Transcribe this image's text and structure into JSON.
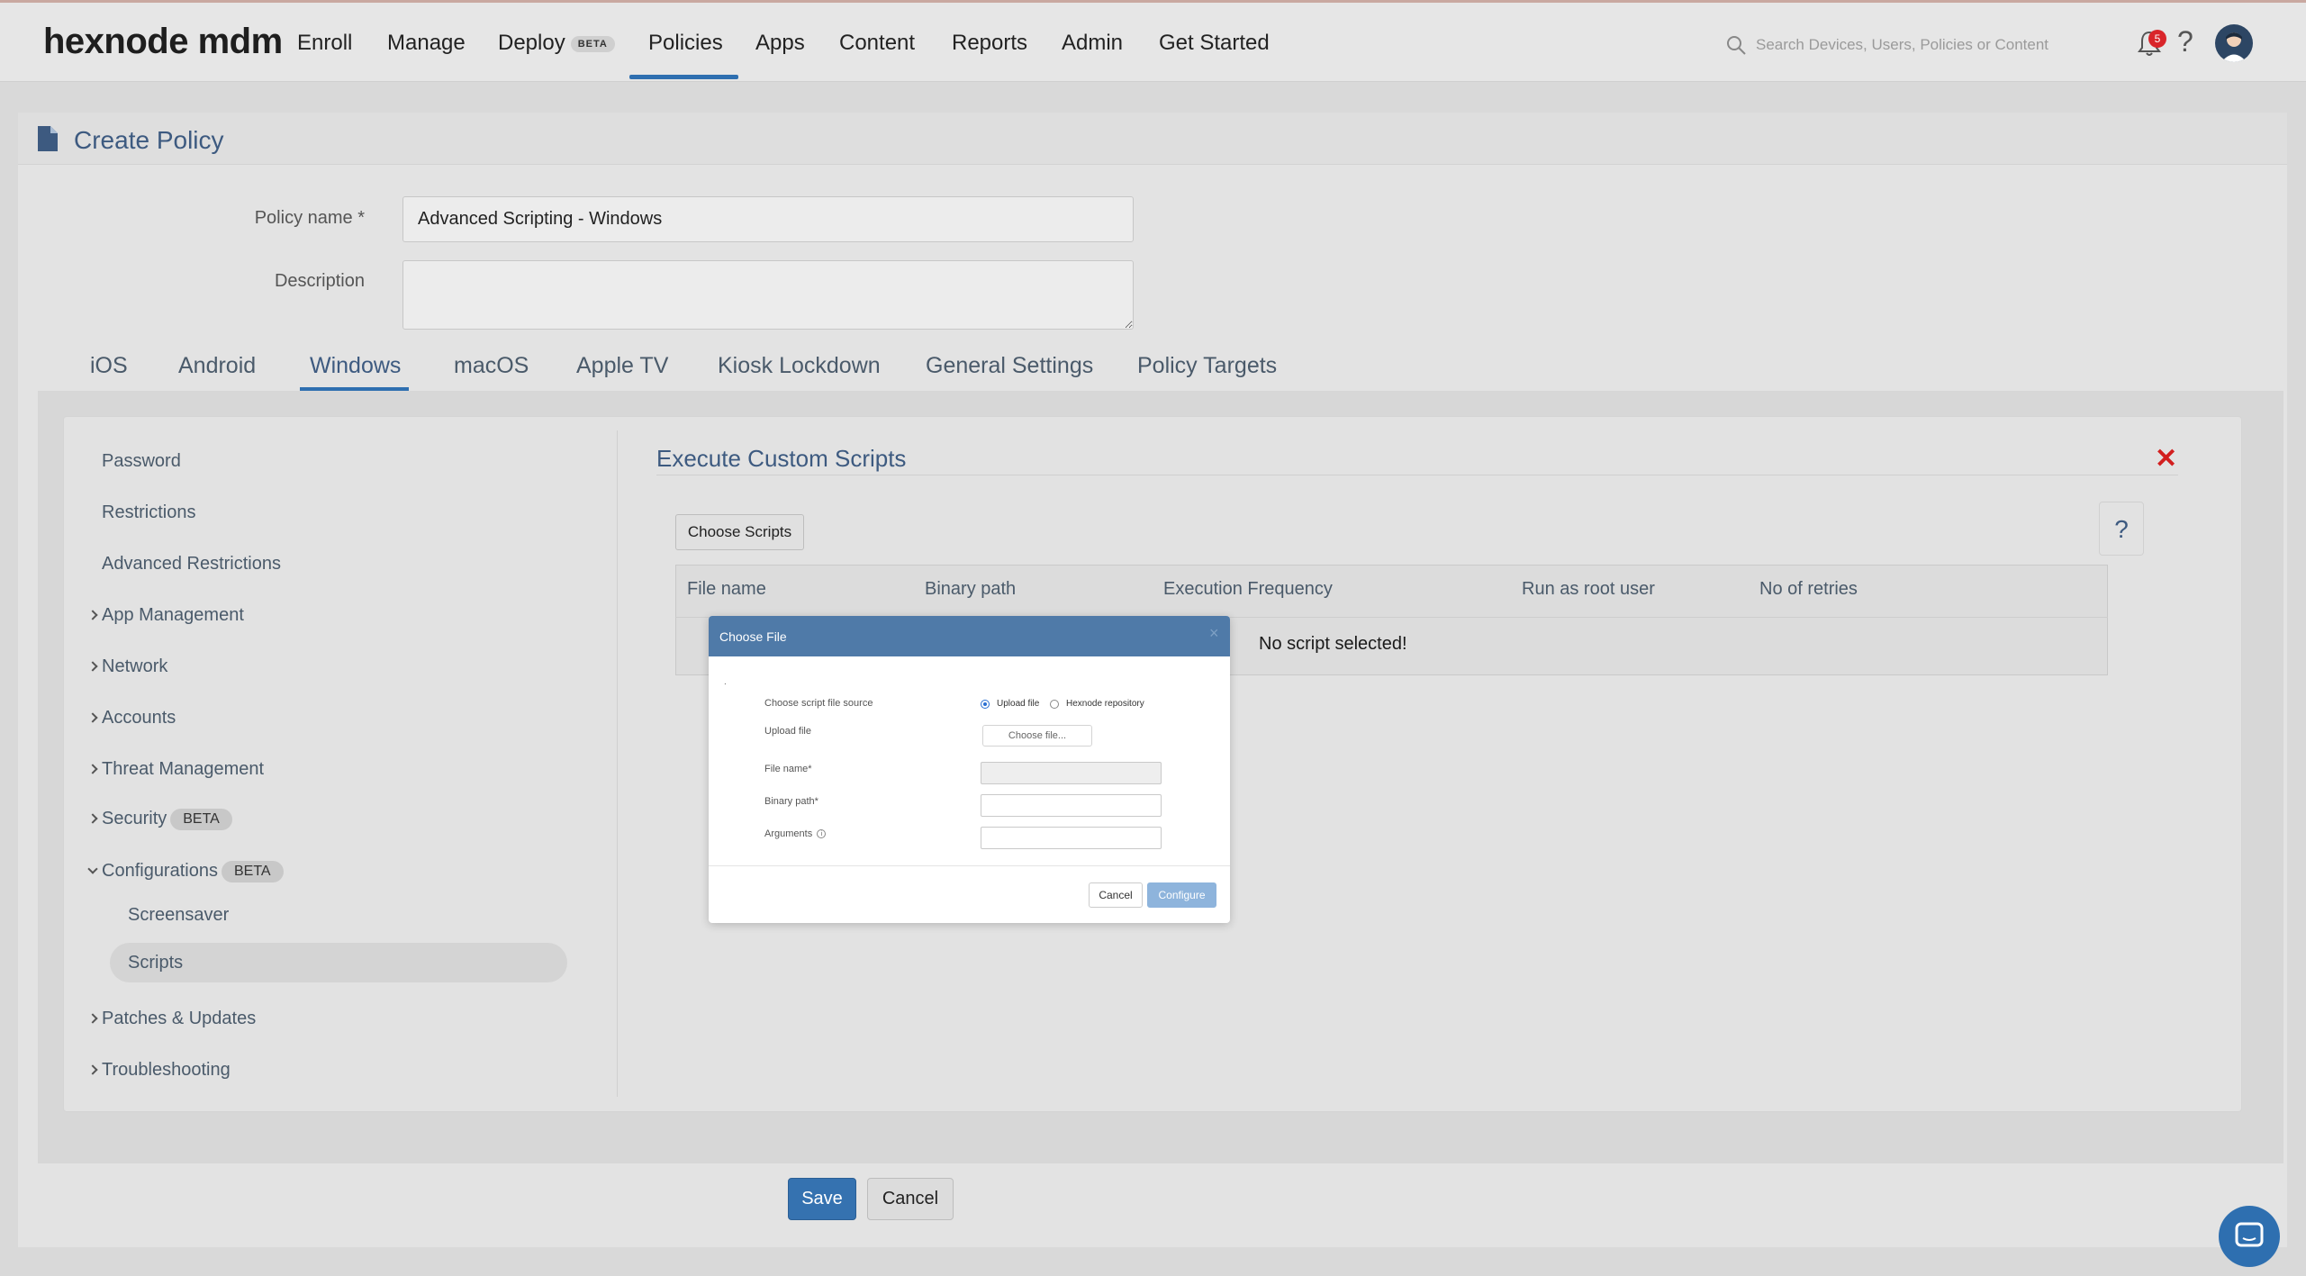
{
  "app": {
    "logo": "hexnode mdm"
  },
  "topnav": {
    "items": [
      "Enroll",
      "Manage",
      "Deploy",
      "Policies",
      "Apps",
      "Content",
      "Reports",
      "Admin",
      "Get Started"
    ],
    "deploy_badge": "BETA",
    "active": "Policies",
    "search_placeholder": "Search Devices, Users, Policies or Content",
    "notification_count": "5",
    "help": "?"
  },
  "page": {
    "title": "Create Policy",
    "policy_name_label": "Policy name *",
    "policy_name_value": "Advanced Scripting - Windows",
    "description_label": "Description",
    "description_value": ""
  },
  "os_tabs": [
    "iOS",
    "Android",
    "Windows",
    "macOS",
    "Apple TV",
    "Kiosk Lockdown",
    "General Settings",
    "Policy Targets"
  ],
  "active_os_tab": "Windows",
  "sidebar": {
    "items": [
      {
        "label": "Password"
      },
      {
        "label": "Restrictions"
      },
      {
        "label": "Advanced Restrictions"
      },
      {
        "label": "App Management"
      },
      {
        "label": "Network"
      },
      {
        "label": "Accounts"
      },
      {
        "label": "Threat Management"
      },
      {
        "label": "Security",
        "badge": "BETA"
      },
      {
        "label": "Configurations",
        "badge": "BETA"
      },
      {
        "label": "Screensaver"
      },
      {
        "label": "Scripts"
      },
      {
        "label": "Patches & Updates"
      },
      {
        "label": "Troubleshooting"
      }
    ],
    "selected": "Scripts"
  },
  "main": {
    "section_title": "Execute Custom Scripts",
    "choose_scripts": "Choose Scripts",
    "help": "?",
    "close": "✕",
    "table": {
      "headers": [
        "File name",
        "Binary path",
        "Execution Frequency",
        "Run as root user",
        "No of retries"
      ],
      "empty_message": "No script selected!"
    }
  },
  "modal": {
    "title": "Choose File",
    "close": "×",
    "dot": ".",
    "source_label": "Choose script file source",
    "source_options": [
      "Upload file",
      "Hexnode repository"
    ],
    "source_selected": "Upload file",
    "upload_label": "Upload file",
    "choose_file_button": "Choose file...",
    "file_name_label": "File name*",
    "binary_path_label": "Binary path*",
    "arguments_label": "Arguments",
    "arguments_info": "i",
    "cancel": "Cancel",
    "configure": "Configure"
  },
  "footer": {
    "save": "Save",
    "cancel": "Cancel"
  },
  "colors": {
    "accent": "#2e6fb0",
    "title": "#3d5a80",
    "modal_header": "#4f7aa8",
    "danger": "#d21f1f"
  }
}
